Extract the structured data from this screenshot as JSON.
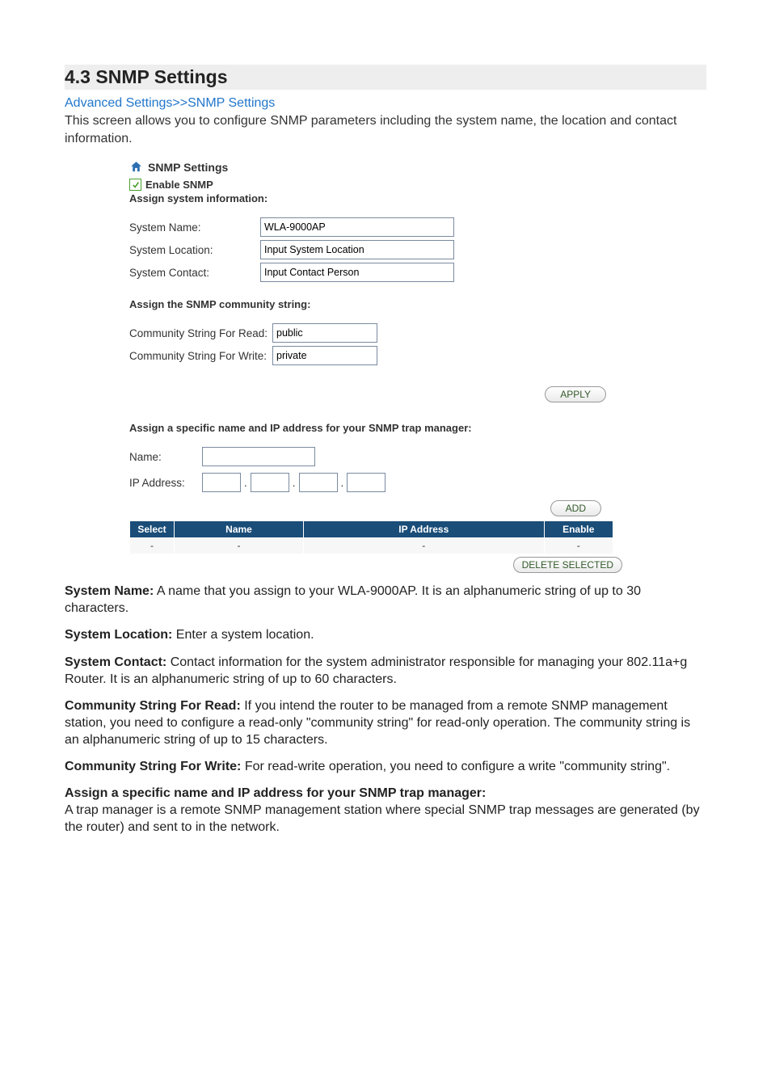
{
  "heading": "4.3 SNMP Settings",
  "breadcrumb": "Advanced Settings>>SNMP Settings",
  "intro": "This screen allows you to configure SNMP parameters including the system name, the location and contact information.",
  "panel": {
    "title": "SNMP Settings",
    "enable_label": "Enable SNMP",
    "enable_checked": true,
    "assign_info_heading": "Assign system information:",
    "system_name_label": "System Name:",
    "system_name_value": "WLA-9000AP",
    "system_location_label": "System Location:",
    "system_location_value": "Input System Location",
    "system_contact_label": "System Contact:",
    "system_contact_value": "Input Contact Person",
    "community_heading": "Assign the SNMP community string:",
    "community_read_label": "Community String For Read:",
    "community_read_value": "public",
    "community_write_label": "Community String For Write:",
    "community_write_value": "private",
    "apply_button": "APPLY",
    "trap_heading": "Assign a specific name and IP address for your SNMP trap manager:",
    "trap_name_label": "Name:",
    "trap_name_value": "",
    "trap_ip_label": "IP Address:",
    "add_button": "ADD",
    "table_cols": {
      "select": "Select",
      "name": "Name",
      "ip": "IP Address",
      "enable": "Enable"
    },
    "table_row": {
      "select": "-",
      "name": "-",
      "ip": "-",
      "enable": "-"
    },
    "delete_button": "DELETE SELECTED"
  },
  "doc": {
    "p1_lead": "System Name:",
    "p1_body": " A name that you assign to your WLA-9000AP. It is an alphanumeric string of up to 30 characters.",
    "p2_lead": "System Location:",
    "p2_body": " Enter a system location.",
    "p3_lead": "System Contact:",
    "p3_body": " Contact information for the system administrator responsible for managing your 802.11a+g Router. It is an alphanumeric string of up to 60 characters.",
    "p4_lead": "Community String For Read:",
    "p4_body": " If you intend the router to be managed from a remote SNMP management station, you need to configure a read-only \"community string\" for read-only operation. The community string is an alphanumeric string of up to 15 characters.",
    "p5_lead": "Community String For Write:",
    "p5_body": " For read-write operation, you need to configure a write \"community string\".",
    "p6_lead": "Assign a specific name and IP address for your SNMP trap manager:",
    "p6_body": "A trap manager is a remote SNMP management station where special SNMP trap messages are generated (by the router) and sent to in the network."
  }
}
